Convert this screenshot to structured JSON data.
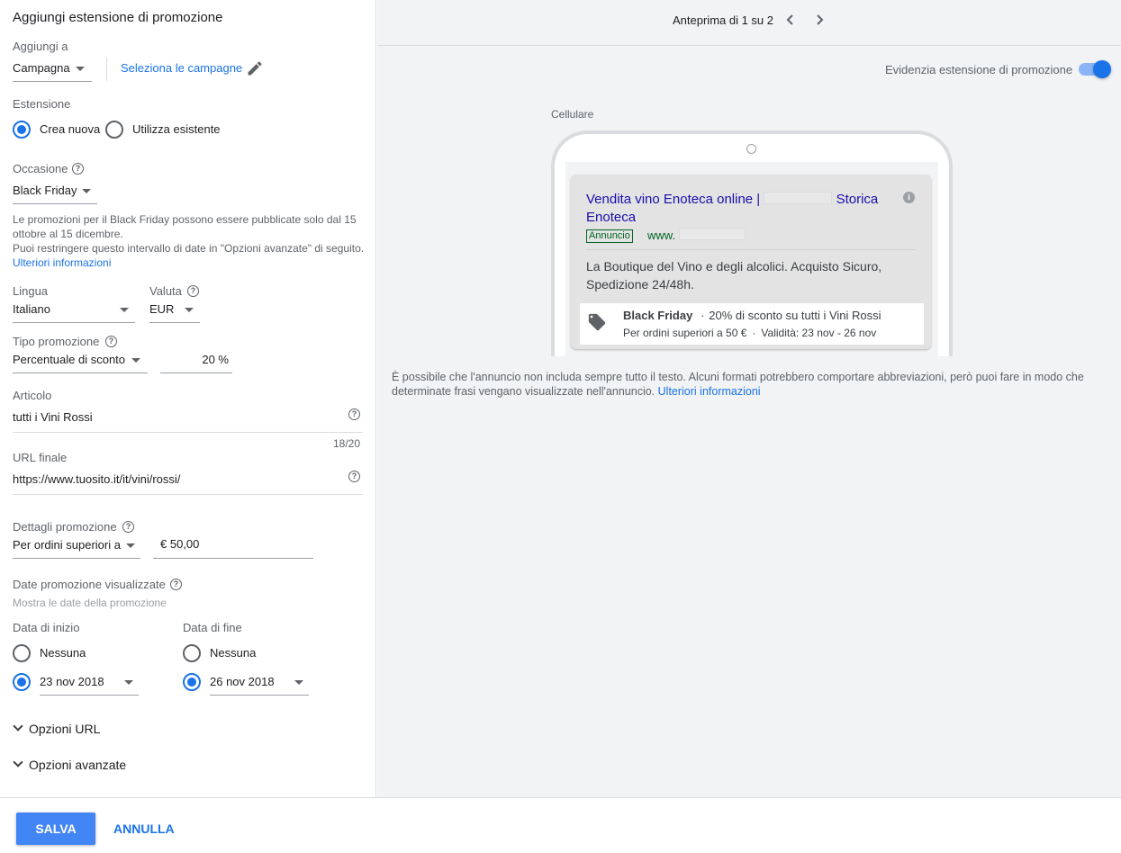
{
  "form": {
    "title": "Aggiungi estensione di promozione",
    "add_to_label": "Aggiungi a",
    "add_to_value": "Campagna",
    "select_campaigns": "Seleziona le campagne",
    "extension_label": "Estensione",
    "create_new": "Crea nuova",
    "use_existing": "Utilizza esistente",
    "occasion_label": "Occasione",
    "occasion_value": "Black Friday",
    "occasion_note_1": "Le promozioni per il Black Friday possono essere pubblicate solo dal 15 ottobre al 15 dicembre.",
    "occasion_note_2": "Puoi restringere questo intervallo di date in \"Opzioni avanzate\" di seguito.",
    "learn_more": "Ulteriori informazioni",
    "language_label": "Lingua",
    "language_value": "Italiano",
    "currency_label": "Valuta",
    "currency_value": "EUR",
    "promo_type_label": "Tipo promozione",
    "promo_type_value": "Percentuale di sconto",
    "promo_percent": "20 %",
    "item_label": "Articolo",
    "item_value": "tutti i Vini Rossi",
    "item_counter": "18/20",
    "url_label": "URL finale",
    "url_value": "https://www.tuosito.it/it/vini/rossi/",
    "details_label": "Dettagli promozione",
    "details_value": "Per ordini superiori a",
    "details_amount": "€ 50,00",
    "dates_label": "Date promozione visualizzate",
    "dates_sub": "Mostra le date della promozione",
    "start_label": "Data di inizio",
    "end_label": "Data di fine",
    "none_label": "Nessuna",
    "start_value": "23 nov 2018",
    "end_value": "26 nov 2018",
    "url_options": "Opzioni URL",
    "advanced_options": "Opzioni avanzate"
  },
  "preview": {
    "pager": "Anteprima di 1 su 2",
    "highlight_label": "Evidenzia estensione di promozione",
    "device_label": "Cellulare",
    "ad_title_1": "Vendita vino Enoteca online |",
    "ad_title_2": "Storica",
    "ad_title_3": "Enoteca",
    "ad_badge": "Annuncio",
    "ad_url": "www.",
    "ad_desc": "La Boutique del Vino e degli alcolici. Acquisto Sicuro, Spedizione 24/48h.",
    "promo_occasion": "Black Friday",
    "promo_text": "20% di sconto su tutti i Vini Rossi",
    "promo_details": "Per ordini superiori a 50 €",
    "promo_validity": "Validità: 23 nov - 26 nov",
    "disclaimer": "È possibile che l'annuncio non includa sempre tutto il testo. Alcuni formati potrebbero comportare abbreviazioni, però puoi fare in modo che determinate frasi vengano visualizzate nell'annuncio.",
    "learn_more": "Ulteriori informazioni"
  },
  "footer": {
    "save": "SALVA",
    "cancel": "ANNULLA"
  },
  "colors": {
    "accent": "#1a73e8",
    "ad_title": "#1a0dab",
    "ad_green": "#006621"
  }
}
